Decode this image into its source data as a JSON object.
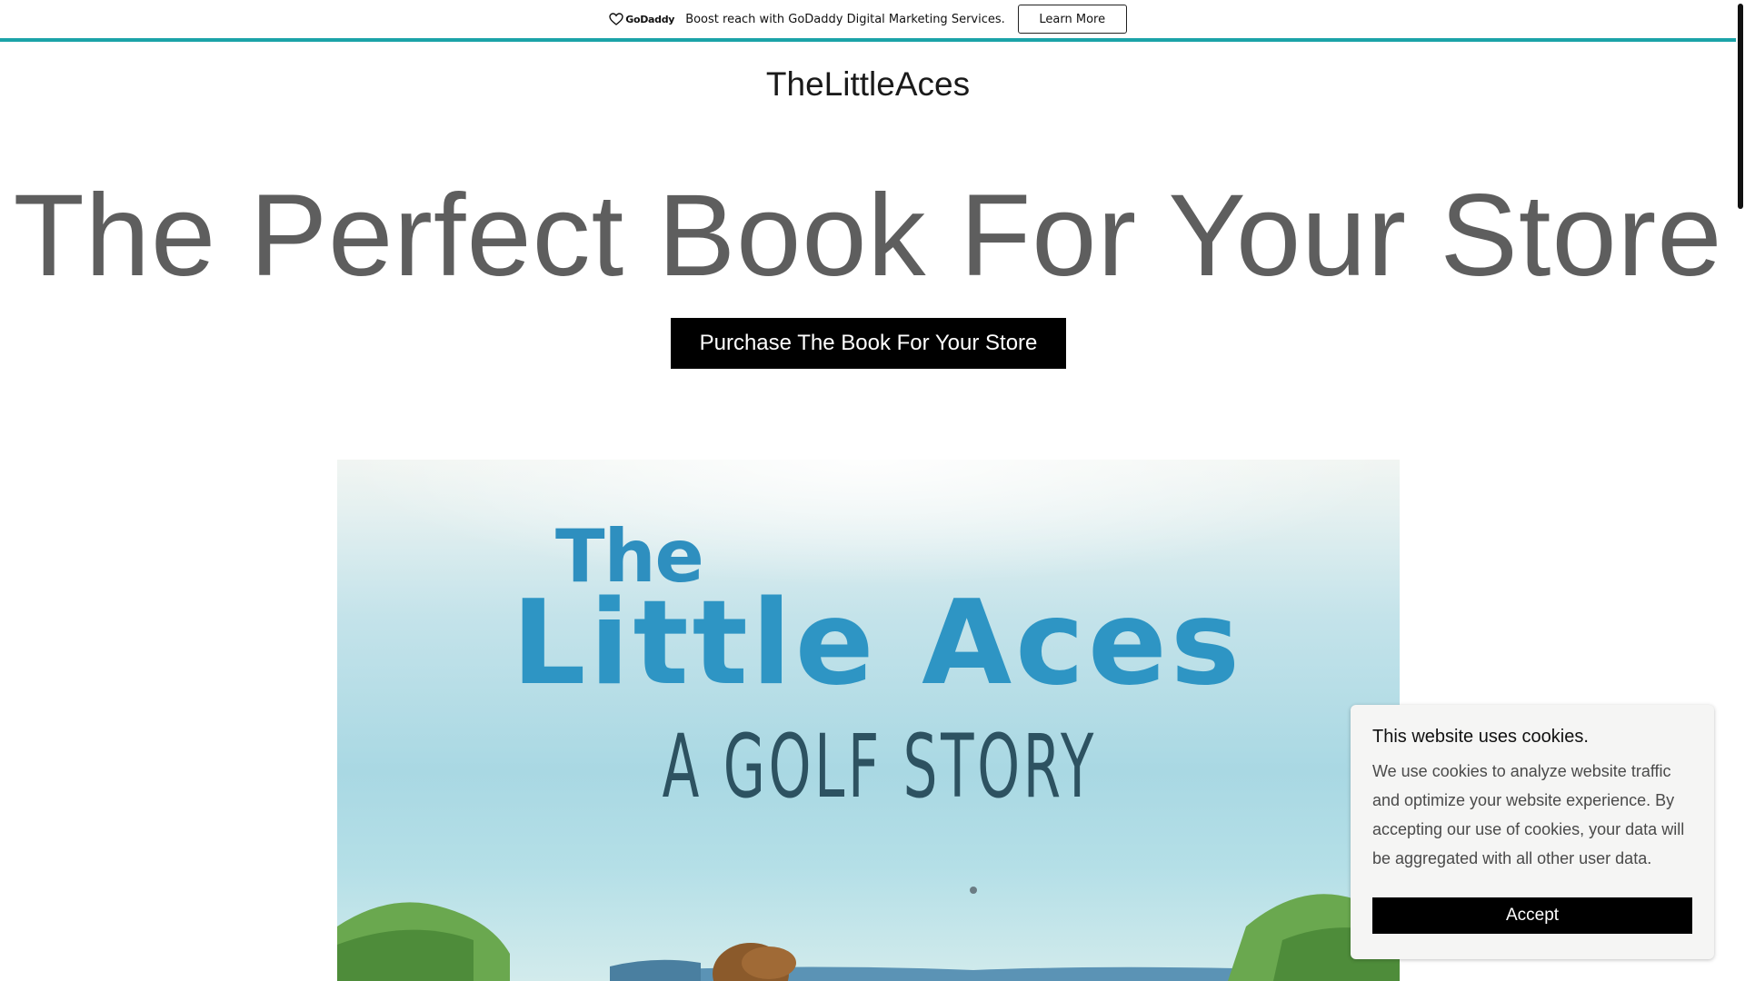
{
  "promo": {
    "logo_text": "GoDaddy",
    "message": "Boost reach with GoDaddy Digital Marketing Services.",
    "button_label": "Learn More",
    "accent_color": "#1ba3a8"
  },
  "header": {
    "site_title": "TheLittleAces"
  },
  "hero": {
    "heading": "The Perfect Book For Your Store",
    "button_label": "Purchase The Book For Your Store"
  },
  "book": {
    "cover_line1": "The",
    "cover_title": "Little Aces",
    "cover_subtitle": "A GOLF STORY"
  },
  "cookie": {
    "title": "This website uses cookies.",
    "body": "We use cookies to analyze website traffic and optimize your website experience. By accepting our use of cookies, your data will be aggregated with all other user data.",
    "accept_label": "Accept"
  }
}
